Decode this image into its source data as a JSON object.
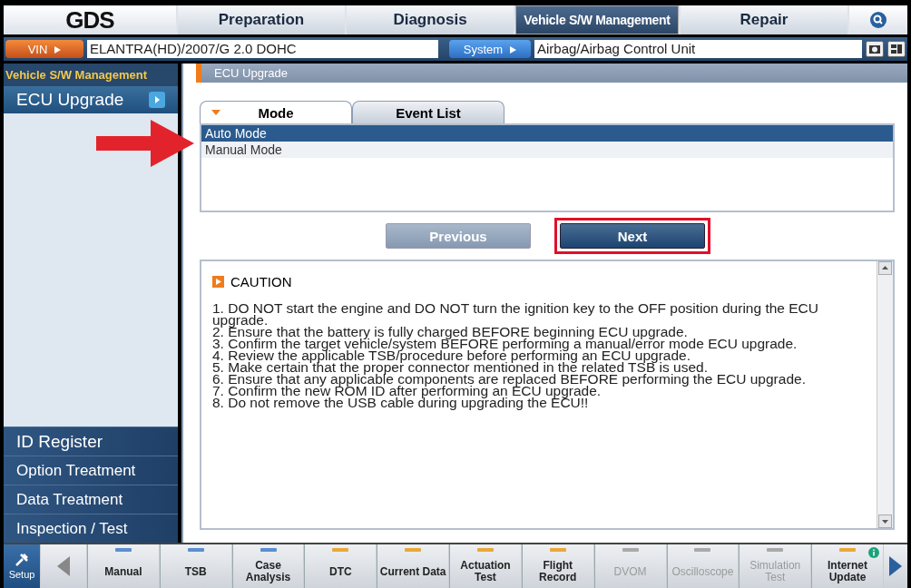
{
  "logo": "GDS",
  "nav_tabs": [
    {
      "label": "Preparation",
      "selected": false
    },
    {
      "label": "Diagnosis",
      "selected": false
    },
    {
      "label": "Vehicle S/W Management",
      "selected": true
    },
    {
      "label": "Repair",
      "selected": false
    }
  ],
  "vin_bar": {
    "vin_button": "VIN",
    "vehicle": "ELANTRA(HD)/2007/G 2.0 DOHC",
    "system_button": "System",
    "system": "Airbag/Airbag Control Unit"
  },
  "sidebar": {
    "title": "Vehicle S/W Management",
    "items": [
      {
        "label": "ECU Upgrade",
        "selected": true
      }
    ],
    "bottom_items": [
      {
        "label": "ID Register"
      },
      {
        "label": "Option Treatment"
      },
      {
        "label": "Data Treatment"
      },
      {
        "label": "Inspection / Test"
      }
    ]
  },
  "breadcrumb": "ECU Upgrade",
  "tabs": [
    {
      "label": "Mode",
      "selected": true
    },
    {
      "label": "Event List",
      "selected": false
    }
  ],
  "modes": [
    {
      "label": "Auto Mode",
      "selected": true
    },
    {
      "label": "Manual Mode",
      "selected": false
    }
  ],
  "buttons": [
    {
      "label": "Previous",
      "disabled": true,
      "highlighted": false
    },
    {
      "label": "Next",
      "disabled": false,
      "highlighted": true
    }
  ],
  "caution": {
    "title": "CAUTION",
    "lines": [
      "1. DO NOT start the engine and DO NOT turn the ignition key to the OFF position during the ECU upgrade.",
      "2. Ensure that the battery is fully charged BEFORE beginning ECU upgrade.",
      "3. Confirm the target vehicle/system BEFORE performing a manual/error mode ECU upgrade.",
      "4. Review the applicable TSB/procedure before performing an ECU upgrade.",
      "5. Make certain that the proper connector mentioned in the related TSB is used.",
      "6. Ensure that any applicable components are replaced BEFORE performing the ECU upgrade.",
      "7. Confirm the new ROM ID after performing an ECU upgrade.",
      "8. Do not remove the USB cable during upgrading the ECU!!"
    ]
  },
  "toolbar": {
    "setup": "Setup",
    "items": [
      {
        "label": "Manual",
        "color": "#5b8fd0",
        "disabled": false
      },
      {
        "label": "TSB",
        "color": "#5b8fd0",
        "disabled": false
      },
      {
        "label": "Case Analysis",
        "color": "#5b8fd0",
        "disabled": false
      },
      {
        "label": "DTC",
        "color": "#e8a93a",
        "disabled": false
      },
      {
        "label": "Current Data",
        "color": "#e8a93a",
        "disabled": false
      },
      {
        "label": "Actuation Test",
        "color": "#e8a93a",
        "disabled": false
      },
      {
        "label": "Flight Record",
        "color": "#e8a93a",
        "disabled": false
      },
      {
        "label": "DVOM",
        "color": "#a9a9a9",
        "disabled": true
      },
      {
        "label": "Oscilloscope",
        "color": "#a9a9a9",
        "disabled": true
      },
      {
        "label": "Simulation Test",
        "color": "#a9a9a9",
        "disabled": true
      },
      {
        "label": "Internet Update",
        "color": "#e8a93a",
        "disabled": false
      }
    ]
  }
}
